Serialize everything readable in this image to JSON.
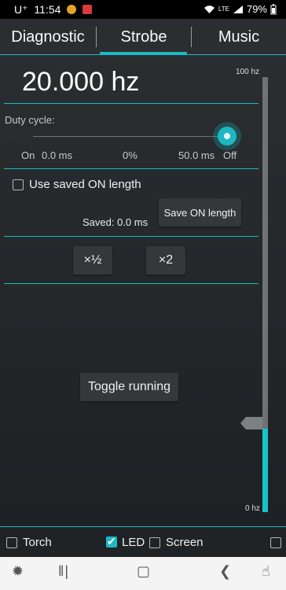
{
  "status_bar": {
    "carrier": "U⁺",
    "time": "11:54",
    "network": "LTE",
    "battery": "79%"
  },
  "tabs": [
    {
      "label": "Diagnostic"
    },
    {
      "label": "Strobe"
    },
    {
      "label": "Music"
    }
  ],
  "frequency": {
    "value": "20.000 hz",
    "max_label": "100 hz",
    "min_label": "0 hz",
    "level": 0.2
  },
  "duty_cycle": {
    "label": "Duty cycle:",
    "on_label": "On",
    "on_value": "0.0 ms",
    "percent": "0%",
    "off_value": "50.0 ms",
    "off_label": "Off",
    "slider_position": 1.0
  },
  "saved_on": {
    "checkbox_label": "Use saved ON length",
    "checked": false,
    "saved_text": "Saved: 0.0 ms",
    "save_button": "Save ON length"
  },
  "multipliers": {
    "half": "×½",
    "double": "×2"
  },
  "toggle_running": "Toggle running",
  "bottom_toggles": {
    "torch": {
      "label": "Torch",
      "checked": false
    },
    "led": {
      "label": "LED",
      "checked": true
    },
    "screen": {
      "label": "Screen",
      "checked": false
    },
    "extra": {
      "checked": false
    }
  },
  "colors": {
    "accent": "#1eb8c2",
    "background": "#26292c"
  },
  "nav_bar": {
    "icons": [
      "accessibility-icon",
      "recent-apps-icon",
      "home-icon",
      "back-icon",
      "assistant-icon"
    ]
  }
}
